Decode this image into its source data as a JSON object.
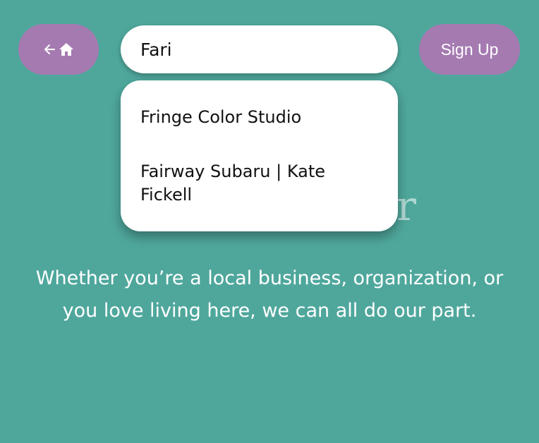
{
  "header": {
    "back_home": {
      "icons": [
        "arrow-left-icon",
        "home-icon"
      ],
      "color": "#a57ab1"
    },
    "signup_label": "Sign Up"
  },
  "search": {
    "value": "Fari",
    "suggestions": [
      "Fringe Color Studio",
      "Fairway Subaru | Kate Fickell"
    ]
  },
  "main": {
    "tagline": "Whether you’re a local business, organization, or you love living here, we can all do our part."
  },
  "colors": {
    "background": "#4fa79c",
    "accent": "#a57ab1",
    "surface": "#ffffff"
  }
}
